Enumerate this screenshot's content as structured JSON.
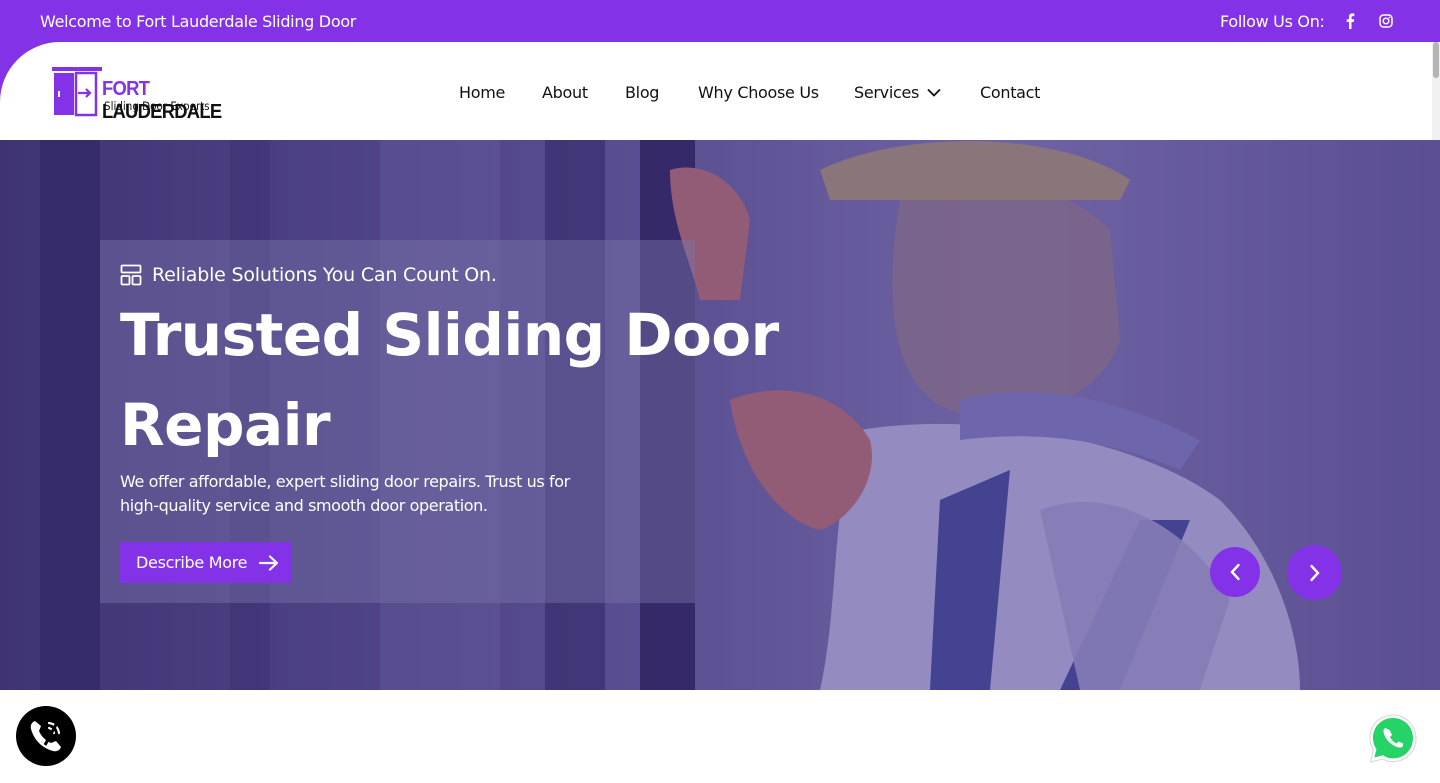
{
  "topbar": {
    "welcome": "Welcome to Fort Lauderdale Sliding Door",
    "follow_label": "Follow Us On:",
    "social_icons": [
      "facebook-icon",
      "instagram-icon"
    ]
  },
  "logo": {
    "brand_first": "FORT ",
    "brand_second": "LAUDERDALE",
    "subtitle": "Sliding Door Experts"
  },
  "nav": {
    "home": "Home",
    "about": "About",
    "blog": "Blog",
    "why": "Why Choose Us",
    "services": "Services",
    "contact": "Contact"
  },
  "hero": {
    "tagline": "Reliable Solutions You Can Count On.",
    "headline": "Trusted Sliding Door Repair",
    "description": "We offer affordable, expert sliding door repairs. Trust us for high-quality service and smooth door operation.",
    "cta_label": "Describe More"
  },
  "colors": {
    "accent": "#8332e8",
    "white": "#ffffff",
    "dark": "#111111"
  }
}
